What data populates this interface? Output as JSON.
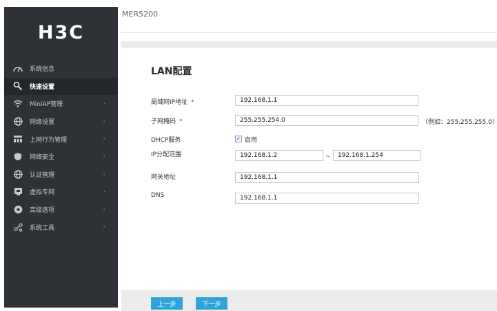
{
  "app": {
    "logo": "H3C",
    "device_title": "MER5200"
  },
  "sidebar": {
    "items": [
      {
        "label": "系统信息",
        "icon": "gauge-icon",
        "active": false,
        "has_arrow": false
      },
      {
        "label": "快速设置",
        "icon": "wrench-icon",
        "active": true,
        "has_arrow": false
      },
      {
        "label": "MiniAP管理",
        "icon": "wifi-icon",
        "active": false,
        "has_arrow": true
      },
      {
        "label": "网络设置",
        "icon": "globe-icon",
        "active": false,
        "has_arrow": true
      },
      {
        "label": "上网行为管理",
        "icon": "network-icon",
        "active": false,
        "has_arrow": true
      },
      {
        "label": "网络安全",
        "icon": "shield-icon",
        "active": false,
        "has_arrow": true
      },
      {
        "label": "认证管理",
        "icon": "globe-icon",
        "active": false,
        "has_arrow": true
      },
      {
        "label": "虚拟专网",
        "icon": "vpn-icon",
        "active": false,
        "has_arrow": true
      },
      {
        "label": "高级选项",
        "icon": "settings-icon",
        "active": false,
        "has_arrow": true
      },
      {
        "label": "系统工具",
        "icon": "share-icon",
        "active": false,
        "has_arrow": true
      }
    ],
    "arrow_glyph": "›"
  },
  "form": {
    "title": "LAN配置",
    "lan_ip": {
      "label": "局域网IP地址",
      "required_mark": "*",
      "value": "192.168.1.1"
    },
    "subnet_mask": {
      "label": "子网掩码",
      "required_mark": "*",
      "value": "255.255.254.0",
      "hint": "（例如：255.255.255.0）"
    },
    "dhcp": {
      "label": "DHCP服务",
      "checkbox_label": "启用",
      "checked": true
    },
    "ip_range": {
      "label": "IP分配范围",
      "start": "192.168.1.2",
      "separator": "~",
      "end": "192.168.1.254"
    },
    "gateway": {
      "label": "网关地址",
      "value": "192.168.1.1"
    },
    "dns": {
      "label": "DNS",
      "value": "192.168.1.1"
    }
  },
  "footer": {
    "prev_label": "上一步",
    "next_label": "下一步"
  },
  "colors": {
    "sidebar_bg": "#2e3237",
    "accent": "#2fa4d9",
    "required": "#d9262c"
  }
}
